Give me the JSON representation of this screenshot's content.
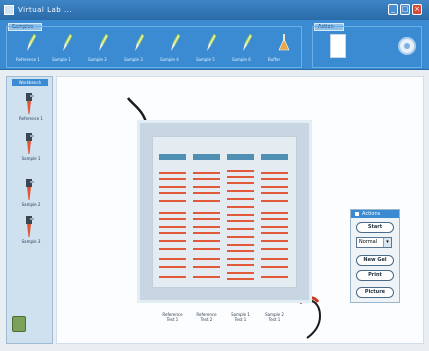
{
  "window": {
    "title": "Virtual Lab ...",
    "buttons": [
      "_",
      "□",
      "×"
    ]
  },
  "toolbar": {
    "samples_group_label": "Samples",
    "action_group_label": "Action",
    "tools": [
      {
        "label": "Reference 1",
        "icon": "micropipette-icon"
      },
      {
        "label": "Sample 1",
        "icon": "micropipette-icon"
      },
      {
        "label": "Sample 2",
        "icon": "micropipette-icon"
      },
      {
        "label": "Sample 3",
        "icon": "micropipette-icon"
      },
      {
        "label": "Sample 4",
        "icon": "micropipette-icon"
      },
      {
        "label": "Sample 5",
        "icon": "micropipette-icon"
      },
      {
        "label": "Sample 6",
        "icon": "micropipette-icon"
      },
      {
        "label": "Buffer",
        "icon": "flask-icon"
      }
    ],
    "action_icons": [
      "notepad-icon",
      "circle-icon"
    ]
  },
  "sidebar": {
    "header": "Workbench",
    "items": [
      {
        "label": "Reference 1"
      },
      {
        "label": "Sample 1"
      },
      {
        "label": "Sample 2"
      },
      {
        "label": "Sample 3"
      }
    ],
    "bottom_icon": "recycle-icon"
  },
  "gel": {
    "lanes": [
      {
        "label_line1": "Reference",
        "label_line2": "Test 1"
      },
      {
        "label_line1": "Reference",
        "label_line2": "Test 2"
      },
      {
        "label_line1": "Sample 1",
        "label_line2": "Test 1"
      },
      {
        "label_line1": "Sample 2",
        "label_line2": "Test 1"
      }
    ]
  },
  "actions_panel": {
    "title": "Actions",
    "start_label": "Start",
    "mode_value": "Normal",
    "new_gel_label": "New Gel",
    "print_label": "Print",
    "picture_label": "Picture"
  },
  "colors": {
    "accent": "#3a8bd1",
    "well": "#4f8fb4",
    "band": "#e15b3b"
  }
}
